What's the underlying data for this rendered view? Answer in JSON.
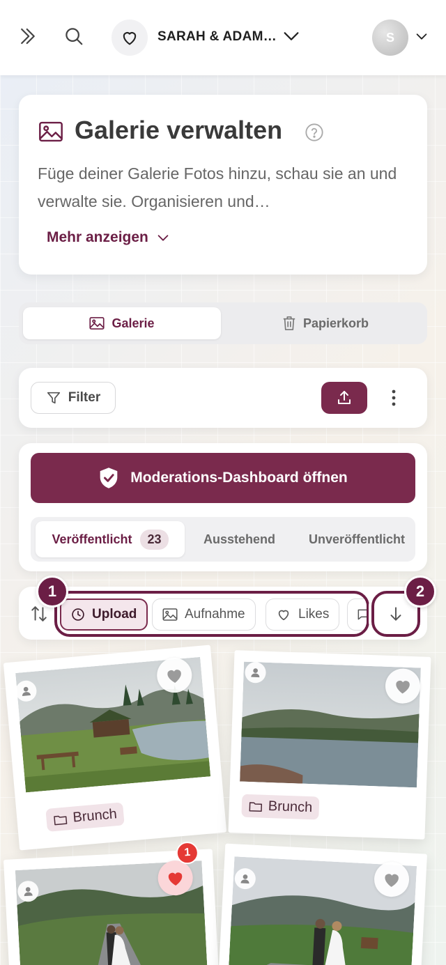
{
  "topbar": {
    "event_title": "SARAH & ADAM…",
    "avatar_initial": "S"
  },
  "header": {
    "title": "Galerie verwalten",
    "description": "Füge deiner Galerie Fotos hinzu, schau sie an und verwalte sie. Organisieren und…",
    "more_label": "Mehr anzeigen"
  },
  "segments": {
    "gallery": "Galerie",
    "trash": "Papierkorb"
  },
  "toolbar": {
    "filter_label": "Filter"
  },
  "moderation": {
    "button_label": "Moderations-Dashboard öffnen",
    "tabs": [
      {
        "label": "Veröffentlicht",
        "count": "23"
      },
      {
        "label": "Ausstehend"
      },
      {
        "label": "Unveröffentlicht"
      }
    ]
  },
  "sort": {
    "chips": [
      "Upload",
      "Aufnahme",
      "Likes"
    ],
    "active_chip": "Upload",
    "step_badges": [
      "1",
      "2"
    ]
  },
  "photos": [
    {
      "album": "Brunch",
      "liked": false
    },
    {
      "album": "Brunch",
      "liked": false
    },
    {
      "album": "",
      "liked": true,
      "like_count": "1"
    },
    {
      "album": "",
      "liked": false
    }
  ],
  "colors": {
    "brand": "#7a2a4d",
    "brand_dark": "#6b1e45",
    "like_red": "#e53935"
  },
  "icons": [
    "chevrons-right-icon",
    "search-icon",
    "heart-icon",
    "chevron-down-icon",
    "image-icon",
    "help-circle-icon",
    "trash-icon",
    "filter-icon",
    "upload-icon",
    "more-vertical-icon",
    "shield-check-icon",
    "sort-icon",
    "clock-icon",
    "arrow-down-icon",
    "user-icon",
    "folder-icon"
  ]
}
